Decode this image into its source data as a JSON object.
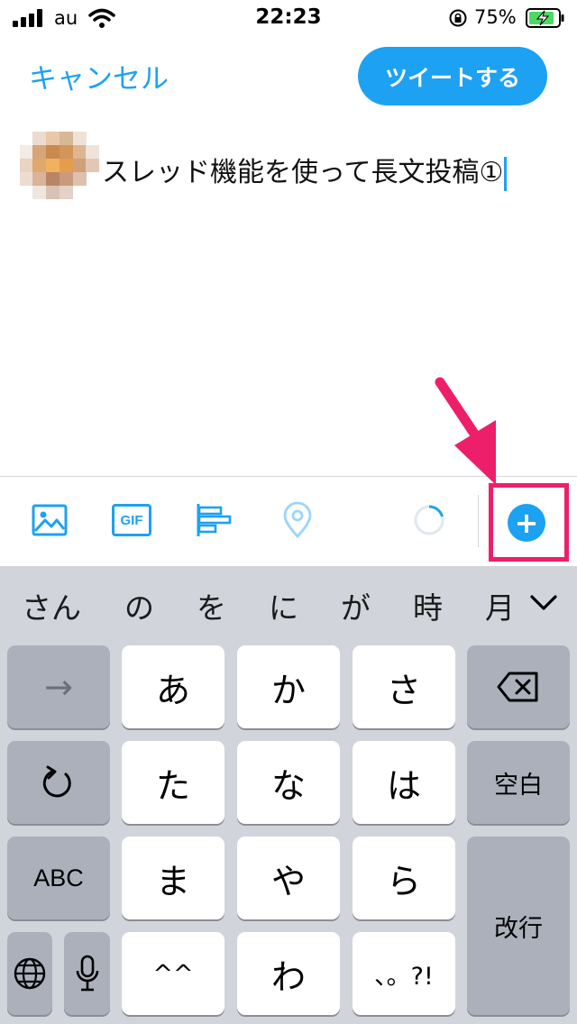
{
  "status": {
    "carrier": "au",
    "time": "22:23",
    "battery": "75%"
  },
  "compose": {
    "cancel": "キャンセル",
    "tweet": "ツイートする",
    "text": "スレッド機能を使って長文投稿①"
  },
  "toolbar": {
    "icons": [
      "image-icon",
      "gif-icon",
      "poll-icon",
      "location-icon",
      "character-count-ring",
      "add-thread-icon"
    ],
    "gif_label": "GIF",
    "add_symbol": "+"
  },
  "keyboard": {
    "candidates": [
      "さん",
      "の",
      "を",
      "に",
      "が",
      "時",
      "月"
    ],
    "rows": {
      "r1": [
        "→",
        "あ",
        "か",
        "さ"
      ],
      "r2": [
        "た",
        "な",
        "は",
        "空白"
      ],
      "r3": [
        "ABC",
        "ま",
        "や",
        "ら",
        "改行"
      ],
      "r4": [
        "^^",
        "わ",
        "、。?!"
      ]
    },
    "icons": [
      "delete-icon",
      "undo-icon",
      "globe-icon",
      "microphone-icon",
      "chevron-down-icon"
    ]
  },
  "colors": {
    "accent": "#1da1f2",
    "annotation": "#ee1f6a",
    "keyboard_bg": "#d1d4db"
  }
}
